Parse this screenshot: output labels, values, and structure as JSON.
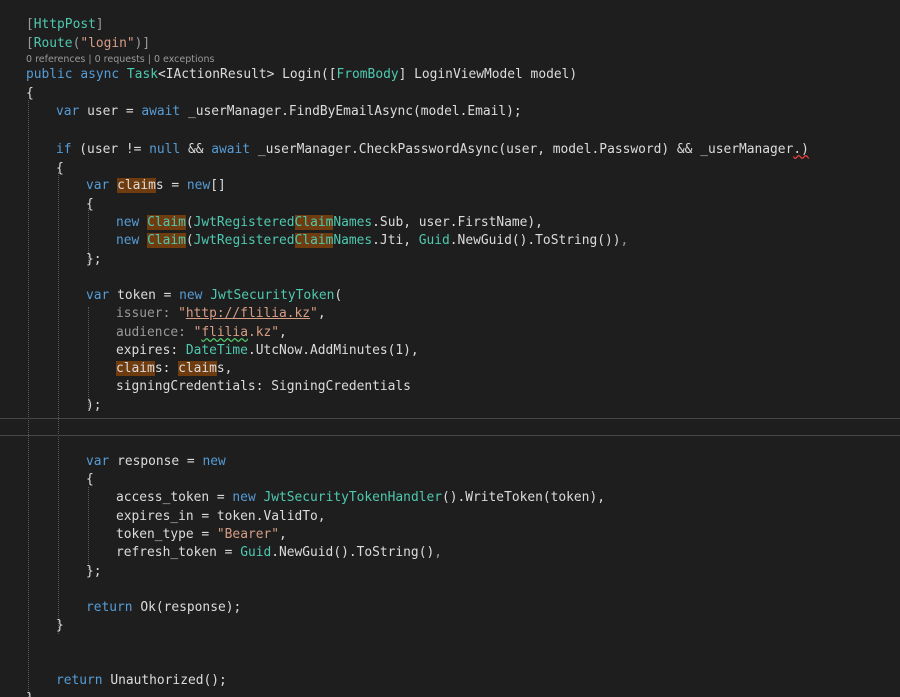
{
  "code_lens": "0 references | 0 requests | 0 exceptions",
  "lines": {
    "l1_attr": "HttpPost",
    "l2_attr": "Route",
    "l2_arg": "\"login\"",
    "l3_public": "public",
    "l3_async": "async",
    "l3_task": "Task",
    "l3_result": "IActionResult",
    "l3_login": "Login",
    "l3_frombody": "FromBody",
    "l3_rest": "LoginViewModel model)",
    "l5_var": "var",
    "l5_user": "user = ",
    "l5_await": "await",
    "l5_call": "_userManager.FindByEmailAsync(model.Email);",
    "l7_if": "if",
    "l7_a": "(user != ",
    "l7_null": "null",
    "l7_b": " && ",
    "l7_await": "await",
    "l7_c": "_userManager.CheckPasswordAsync(user, model.Password) && _userManager",
    "l7_err": ".)",
    "l9_var": "var",
    "l9_claim": "claim",
    "l9_s": "s = ",
    "l9_new": "new",
    "l11_new": "new",
    "l11_claim": "Claim",
    "l11_type": "JwtRegistered",
    "l11_claim2": "Claim",
    "l11_type2": "Names",
    "l11_rest": ".Sub, user.FirstName),",
    "l12_new": "new",
    "l12_claim": "Claim",
    "l12_type": "JwtRegistered",
    "l12_claim2": "Claim",
    "l12_type2": "Names",
    "l12_mid": ".Jti, ",
    "l12_guid": "Guid",
    "l12_rest": ".NewGuid().ToString())",
    "l15_var": "var",
    "l15_token": "token = ",
    "l15_new": "new",
    "l15_type": "JwtSecurityToken",
    "l16_param": "issuer:",
    "l16_link": "http://flilia.kz",
    "l17_param": "audience:",
    "l17_str_a": "\"",
    "l17_str_sq": "flilia",
    "l17_str_b": ".kz\"",
    "l18_param": "expires:",
    "l18_type": "DateTime",
    "l18_rest": ".UtcNow.AddMinutes(1),",
    "l19_claim": "claim",
    "l19_mid": "s: ",
    "l19_claim2": "claim",
    "l19_end": "s,",
    "l20_text": "signingCredentials: SigningCredentials",
    "l24_var": "var",
    "l24_resp": "response = ",
    "l24_new": "new",
    "l26_a": "access_token = ",
    "l26_new": "new",
    "l26_type": "JwtSecurityTokenHandler",
    "l26_rest": "().WriteToken(token),",
    "l27_text": "expires_in = token.ValidTo,",
    "l28_a": "token_type = ",
    "l28_str": "\"Bearer\"",
    "l29_a": "refresh_token = ",
    "l29_guid": "Guid",
    "l29_rest": ".NewGuid().ToString()",
    "l31_return": "return",
    "l31_rest": "Ok(response);",
    "l35_return": "return",
    "l35_rest": "Unauthorized();"
  },
  "colors": {
    "background": "#1e1e1e",
    "keyword": "#569cd6",
    "type": "#4ec9b0",
    "string": "#d69d85",
    "highlight": "#6f3c10"
  }
}
